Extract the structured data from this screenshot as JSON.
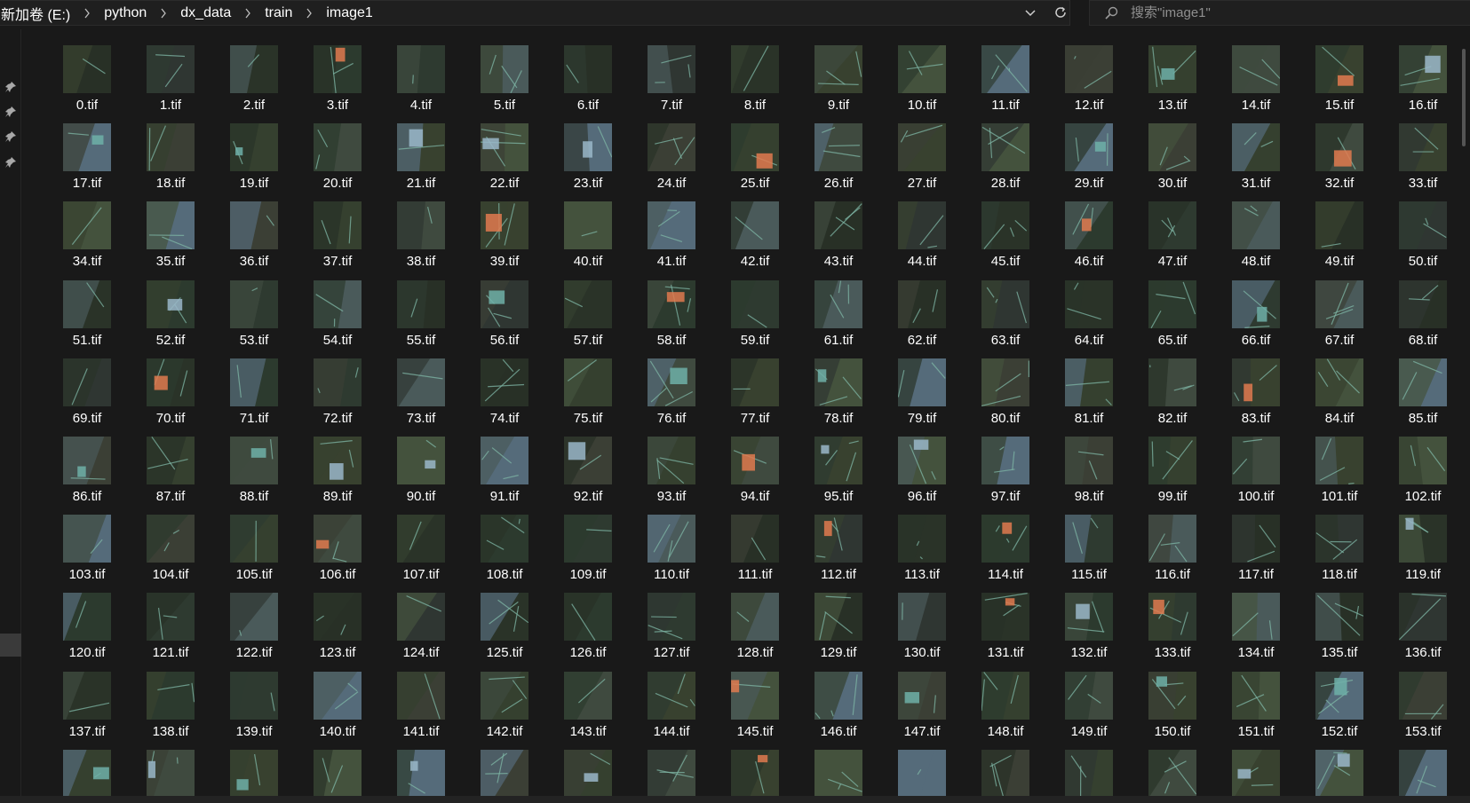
{
  "address_bar": {
    "breadcrumbs": [
      "新加卷 (E:)",
      "python",
      "dx_data",
      "train",
      "image1"
    ],
    "separator_icon": "chevron-right-icon",
    "dropdown_icon": "chevron-down-icon",
    "refresh_icon": "refresh-icon"
  },
  "search": {
    "placeholder": "搜索\"image1\"",
    "value": "",
    "icon": "search-icon"
  },
  "navigation_pane": {
    "pin_icons": [
      "pin-icon",
      "pin-icon",
      "pin-icon",
      "pin-icon"
    ]
  },
  "files": {
    "columns": 17,
    "names": [
      "0.tif",
      "1.tif",
      "2.tif",
      "3.tif",
      "4.tif",
      "5.tif",
      "6.tif",
      "7.tif",
      "8.tif",
      "9.tif",
      "10.tif",
      "11.tif",
      "12.tif",
      "13.tif",
      "14.tif",
      "15.tif",
      "16.tif",
      "17.tif",
      "18.tif",
      "19.tif",
      "20.tif",
      "21.tif",
      "22.tif",
      "23.tif",
      "24.tif",
      "25.tif",
      "26.tif",
      "27.tif",
      "28.tif",
      "29.tif",
      "30.tif",
      "31.tif",
      "32.tif",
      "33.tif",
      "34.tif",
      "35.tif",
      "36.tif",
      "37.tif",
      "38.tif",
      "39.tif",
      "40.tif",
      "41.tif",
      "42.tif",
      "43.tif",
      "44.tif",
      "45.tif",
      "46.tif",
      "47.tif",
      "48.tif",
      "49.tif",
      "50.tif",
      "51.tif",
      "52.tif",
      "53.tif",
      "54.tif",
      "55.tif",
      "56.tif",
      "57.tif",
      "58.tif",
      "59.tif",
      "61.tif",
      "62.tif",
      "63.tif",
      "64.tif",
      "65.tif",
      "66.tif",
      "67.tif",
      "68.tif",
      "69.tif",
      "70.tif",
      "71.tif",
      "72.tif",
      "73.tif",
      "74.tif",
      "75.tif",
      "76.tif",
      "77.tif",
      "78.tif",
      "79.tif",
      "80.tif",
      "81.tif",
      "82.tif",
      "83.tif",
      "84.tif",
      "85.tif",
      "86.tif",
      "87.tif",
      "88.tif",
      "89.tif",
      "90.tif",
      "91.tif",
      "92.tif",
      "93.tif",
      "94.tif",
      "95.tif",
      "96.tif",
      "97.tif",
      "98.tif",
      "99.tif",
      "100.tif",
      "101.tif",
      "102.tif",
      "103.tif",
      "104.tif",
      "105.tif",
      "106.tif",
      "107.tif",
      "108.tif",
      "109.tif",
      "110.tif",
      "111.tif",
      "112.tif",
      "113.tif",
      "114.tif",
      "115.tif",
      "116.tif",
      "117.tif",
      "118.tif",
      "119.tif",
      "120.tif",
      "121.tif",
      "122.tif",
      "123.tif",
      "124.tif",
      "125.tif",
      "126.tif",
      "127.tif",
      "128.tif",
      "129.tif",
      "130.tif",
      "131.tif",
      "132.tif",
      "133.tif",
      "134.tif",
      "135.tif",
      "136.tif",
      "137.tif",
      "138.tif",
      "139.tif",
      "140.tif",
      "141.tif",
      "142.tif",
      "143.tif",
      "144.tif",
      "145.tif",
      "146.tif",
      "147.tif",
      "148.tif",
      "149.tif",
      "150.tif",
      "151.tif",
      "152.tif",
      "153.tif",
      "",
      "",
      "",
      "",
      "",
      "",
      "",
      "",
      "",
      "",
      "",
      "",
      "",
      "",
      "",
      "",
      ""
    ],
    "thumbnail_colors": [
      "#2c3a2e",
      "#38412f",
      "#2a3328",
      "#3f4a3f",
      "#2f3632",
      "#35402f",
      "#283026",
      "#3b3f35",
      "#4a5a5a",
      "#556b7a",
      "#2e3a30",
      "#44523d"
    ],
    "accent_colors": [
      "#e07a4f",
      "#6fb0a8",
      "#9ab7c9"
    ]
  }
}
